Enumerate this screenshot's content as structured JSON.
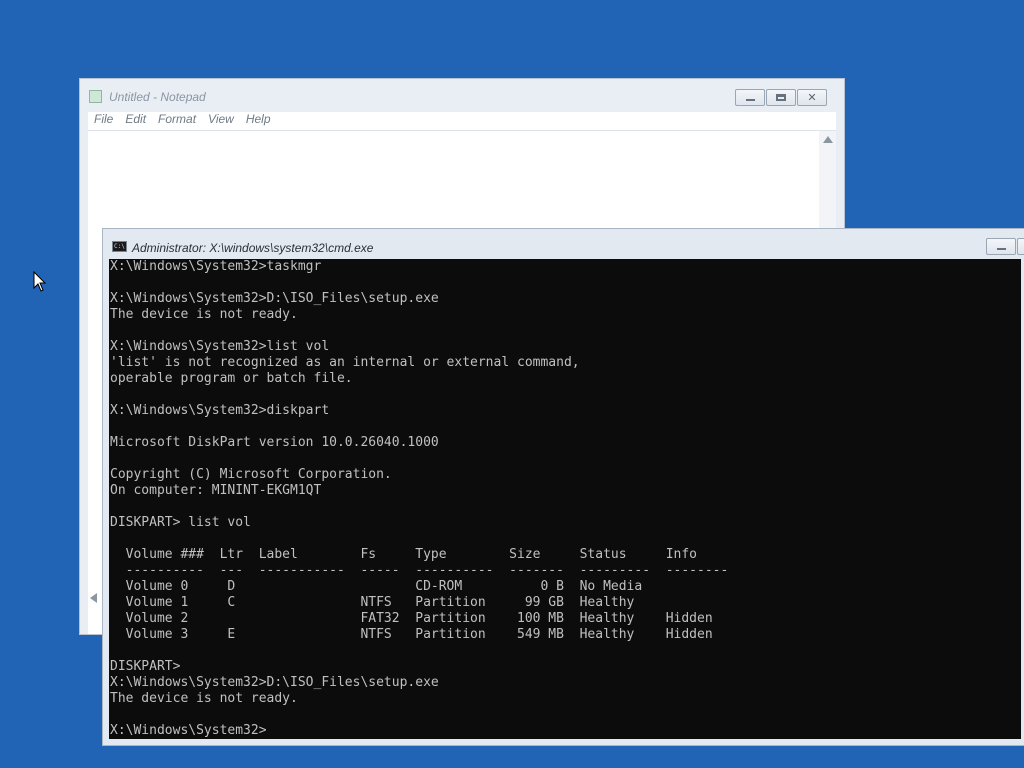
{
  "notepad": {
    "title": "Untitled - Notepad",
    "menu": [
      "File",
      "Edit",
      "Format",
      "View",
      "Help"
    ],
    "content": ""
  },
  "cmd": {
    "title": "Administrator: X:\\windows\\system32\\cmd.exe",
    "icon_text": "C:\\",
    "lines": [
      "X:\\Windows\\System32>taskmgr",
      "",
      "X:\\Windows\\System32>D:\\ISO_Files\\setup.exe",
      "The device is not ready.",
      "",
      "X:\\Windows\\System32>list vol",
      "'list' is not recognized as an internal or external command,",
      "operable program or batch file.",
      "",
      "X:\\Windows\\System32>diskpart",
      "",
      "Microsoft DiskPart version 10.0.26040.1000",
      "",
      "Copyright (C) Microsoft Corporation.",
      "On computer: MININT-EKGM1QT",
      "",
      "DISKPART> list vol",
      "",
      "  Volume ###  Ltr  Label        Fs     Type        Size     Status     Info",
      "  ----------  ---  -----------  -----  ----------  -------  ---------  --------",
      "  Volume 0     D                       CD-ROM          0 B  No Media",
      "  Volume 1     C                NTFS   Partition     99 GB  Healthy",
      "  Volume 2                      FAT32  Partition    100 MB  Healthy    Hidden",
      "  Volume 3     E                NTFS   Partition    549 MB  Healthy    Hidden",
      "",
      "DISKPART>",
      "X:\\Windows\\System32>D:\\ISO_Files\\setup.exe",
      "The device is not ready.",
      "",
      "X:\\Windows\\System32>"
    ]
  },
  "colors": {
    "desktop": "#2164b5",
    "console_bg": "#0c0c0c",
    "console_fg": "#c0c0c0"
  },
  "icons": {
    "cursor": "arrow-pointer-icon",
    "minimize": "minimize-icon",
    "maximize": "maximize-icon",
    "close": "close-icon"
  }
}
